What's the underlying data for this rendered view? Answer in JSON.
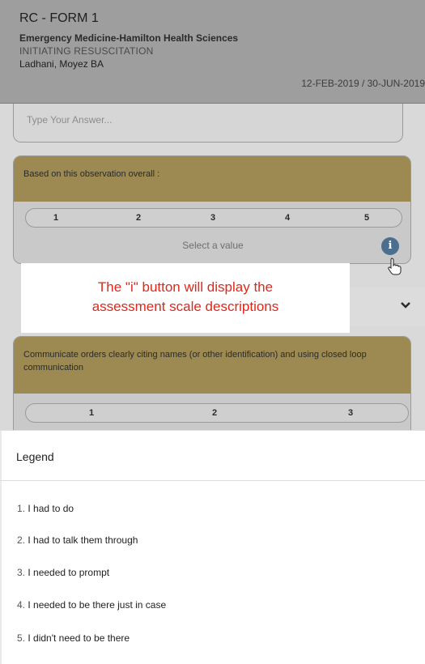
{
  "header": {
    "form_title": "RC - FORM 1",
    "organization": "Emergency Medicine-Hamilton Health Sciences",
    "section": "INITIATING RESUSCITATION",
    "person": "Ladhani, Moyez BA",
    "dates": "12-FEB-2019 / 30-JUN-2019"
  },
  "answer": {
    "placeholder": "Type Your Answer..."
  },
  "question1": {
    "text": "Based on this observation overall :",
    "scale": [
      "1",
      "2",
      "3",
      "4",
      "5"
    ],
    "select_prompt": "Select a value",
    "info_label": "i"
  },
  "callout": {
    "line1": "The \"i\" button will display the",
    "line2": "assessment scale descriptions",
    "color": "#e32619"
  },
  "question2": {
    "text": "Communicate orders clearly citing names (or other identification) and using closed loop communication",
    "scale": [
      "1",
      "2",
      "3"
    ]
  },
  "legend": {
    "title": "Legend",
    "items": [
      {
        "num": "1.",
        "text": "I had to do"
      },
      {
        "num": "2.",
        "text": "I had to talk them through"
      },
      {
        "num": "3.",
        "text": "I needed to prompt"
      },
      {
        "num": "4.",
        "text": "I needed to be there just in case"
      },
      {
        "num": "5.",
        "text": "I didn't need to be there"
      }
    ]
  },
  "icons": {
    "info": "info-icon",
    "pointer": "hand-pointer-icon",
    "chevron": "chevron-down-icon"
  },
  "colors": {
    "question_header": "#9c8a52",
    "info_button": "#4a6f8f",
    "callout_text": "#e32619"
  }
}
